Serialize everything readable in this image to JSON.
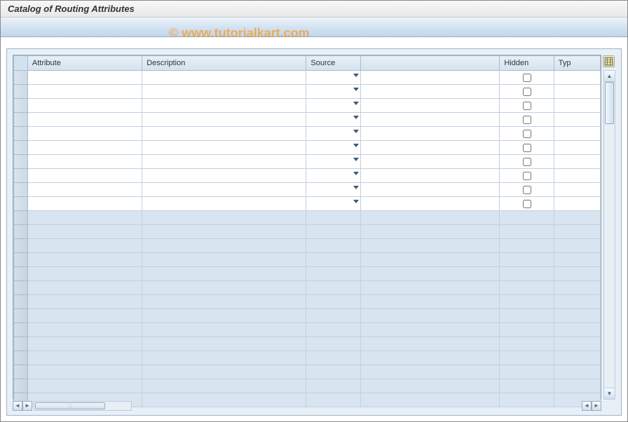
{
  "title": "Catalog of Routing Attributes",
  "watermark": "© www.tutorialkart.com",
  "columns": {
    "attribute": "Attribute",
    "description": "Description",
    "source": "Source",
    "hidden": "Hidden",
    "typ": "Typ"
  },
  "active_row_count": 10,
  "inactive_row_count": 14,
  "rows": [
    {
      "attribute": "",
      "description": "",
      "source": "",
      "hidden": false,
      "typ": ""
    },
    {
      "attribute": "",
      "description": "",
      "source": "",
      "hidden": false,
      "typ": ""
    },
    {
      "attribute": "",
      "description": "",
      "source": "",
      "hidden": false,
      "typ": ""
    },
    {
      "attribute": "",
      "description": "",
      "source": "",
      "hidden": false,
      "typ": ""
    },
    {
      "attribute": "",
      "description": "",
      "source": "",
      "hidden": false,
      "typ": ""
    },
    {
      "attribute": "",
      "description": "",
      "source": "",
      "hidden": false,
      "typ": ""
    },
    {
      "attribute": "",
      "description": "",
      "source": "",
      "hidden": false,
      "typ": ""
    },
    {
      "attribute": "",
      "description": "",
      "source": "",
      "hidden": false,
      "typ": ""
    },
    {
      "attribute": "",
      "description": "",
      "source": "",
      "hidden": false,
      "typ": ""
    },
    {
      "attribute": "",
      "description": "",
      "source": "",
      "hidden": false,
      "typ": ""
    }
  ]
}
